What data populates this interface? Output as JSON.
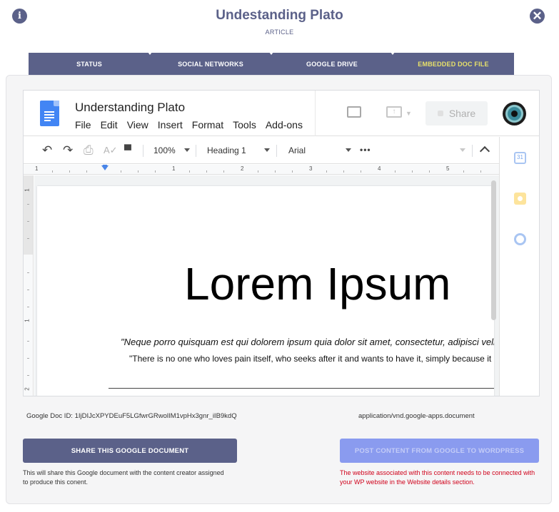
{
  "header": {
    "title": "Undestanding Plato",
    "subtitle": "ARTICLE"
  },
  "tabs": [
    {
      "label": "STATUS"
    },
    {
      "label": "SOCIAL NETWORKS"
    },
    {
      "label": "GOOGLE DRIVE"
    },
    {
      "label": "EMBEDDED DOC FILE",
      "active": true
    }
  ],
  "colors": {
    "primary": "#5b6189",
    "active_tab_text": "#e8e16a",
    "disabled_button": "#8a9bef",
    "error_text": "#d0021b"
  },
  "embed": {
    "doc_title": "Understanding Plato",
    "menu": [
      "File",
      "Edit",
      "View",
      "Insert",
      "Format",
      "Tools",
      "Add-ons"
    ],
    "share_label": "Share",
    "toolbar": {
      "zoom": "100%",
      "style": "Heading 1",
      "font": "Arial"
    },
    "ruler_numbers": [
      "1",
      "1",
      "2",
      "3",
      "4",
      "5"
    ],
    "vruler_numbers": [
      "1",
      "1",
      "2"
    ],
    "content": {
      "heading": "Lorem Ipsum",
      "quote_latin": "\"Neque porro quisquam est qui dolorem ipsum quia dolor sit amet, consectetur, adipisci velit...\"",
      "quote_english": "\"There is no one who loves pain itself, who seeks after it and wants to have it, simply because it is pain...\""
    }
  },
  "meta": {
    "doc_id": "Google Doc ID: 1IjDIJcXPYDEuF5LGfwrGRwolIM1vpHx3gnr_iIB9kdQ",
    "mime_type": "application/vnd.google-apps.document"
  },
  "actions": {
    "share_label": "SHARE THIS GOOGLE DOCUMENT",
    "share_note": "This will share this Google document with the content creator assigned to produce this conent.",
    "post_label": "POST CONTENT FROM GOOGLE TO WORDPRESS",
    "post_note": "The website associated with this content needs to be connected with your WP website in the Website details section."
  }
}
